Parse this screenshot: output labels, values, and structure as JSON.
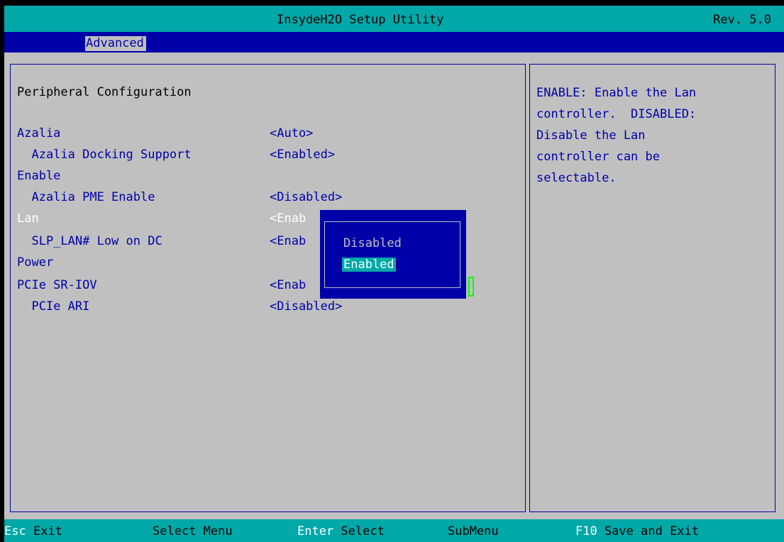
{
  "header": {
    "title": "InsydeH2O Setup Utility",
    "revision": "Rev. 5.0"
  },
  "menu": {
    "tabs": [
      {
        "label": "Advanced"
      }
    ]
  },
  "main": {
    "section_title": "Peripheral Configuration",
    "rows": [
      {
        "label": "Azalia",
        "value": "<Auto>"
      },
      {
        "label": "  Azalia Docking Support",
        "value": "<Enabled>"
      },
      {
        "label": "Enable",
        "value": ""
      },
      {
        "label": "  Azalia PME Enable",
        "value": "<Disabled>"
      },
      {
        "label": "Lan",
        "value": "<Enab"
      },
      {
        "label": "  SLP_LAN# Low on DC",
        "value": "<Enab"
      },
      {
        "label": "Power",
        "value": ""
      },
      {
        "label": "PCIe SR-IOV",
        "value": "<Enab"
      },
      {
        "label": "  PCIe ARI",
        "value": "<Disabled>"
      }
    ]
  },
  "help": {
    "text": "ENABLE: Enable the Lan\ncontroller.  DISABLED:\nDisable the Lan\ncontroller can be\nselectable."
  },
  "popup": {
    "options": [
      {
        "label": "Disabled"
      },
      {
        "label": "Enabled"
      }
    ],
    "selected": "Enabled"
  },
  "status_bar": {
    "items": [
      {
        "key": "Esc",
        "label": " Exit"
      },
      {
        "key": "",
        "label": "Select Menu"
      },
      {
        "key": "Enter",
        "label": " Select"
      },
      {
        "key": "",
        "label": "SubMenu"
      },
      {
        "key": "F10",
        "label": " Save and Exit"
      }
    ]
  },
  "colors": {
    "background": "#c0c0c0",
    "title_bar": "#00a8a8",
    "menu_bar": "#0000a8",
    "text_blue": "#0000a8",
    "highlight": "#00a8a8",
    "selected_text": "#ffffff"
  }
}
